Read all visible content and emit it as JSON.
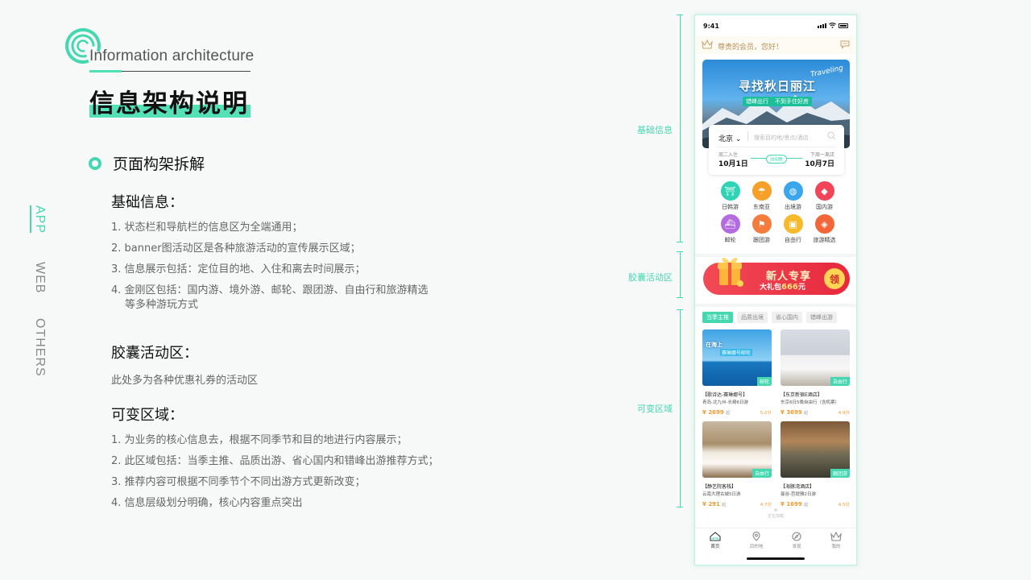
{
  "header": {
    "en_title": "Information architecture",
    "cn_title": "信息架构说明"
  },
  "side_tabs": [
    "APP",
    "WEB",
    "OTHERS"
  ],
  "section": {
    "title": "页面构架拆解",
    "basic": {
      "title": "基础信息：",
      "items": [
        "1. 状态栏和导航栏的信息区为全端通用；",
        "2. banner图活动区是各种旅游活动的宣传展示区域；",
        "3. 信息展示包括：定位目的地、入住和离去时间展示；",
        "4. 金刚区包括：国内游、境外游、邮轮、跟团游、自由行和旅游精选"
      ],
      "item4_cont": "等多种游玩方式"
    },
    "capsule": {
      "title": "胶囊活动区：",
      "text": "此处多为各种优惠礼券的活动区"
    },
    "variable": {
      "title": "可变区域：",
      "items": [
        "1. 为业务的核心信息去，根据不同季节和目的地进行内容展示；",
        "2. 此区域包括：当季主推、品质出游、省心国内和错峰出游推荐方式；",
        "3. 推荐内容可根据不同季节个不同出游方式更新改变；",
        "4. 信息层级划分明确，核心内容重点突出"
      ]
    }
  },
  "annotations": {
    "basic": "基础信息",
    "capsule": "胶囊活动区",
    "variable": "可变区域"
  },
  "phone": {
    "time": "9:41",
    "greeting": "尊贵的会员，您好！",
    "banner": {
      "title": "寻找秋日丽江",
      "script": "Traveling",
      "chip1": "错峰出行",
      "chip2": "不到手住好房"
    },
    "search": {
      "city": "北京",
      "placeholder": "搜索目的地/景点/酒店",
      "checkin_label": "周二入住",
      "checkin": "10月1日",
      "checkout_label": "下周一离店",
      "checkout": "10月7日",
      "nights": "共6晚"
    },
    "categories": [
      {
        "label": "日韩游",
        "icon": "torii-icon",
        "color": "#2fd3b5",
        "glyph": "⛩"
      },
      {
        "label": "东南亚",
        "icon": "island-icon",
        "color": "#f6a02a",
        "glyph": "☂"
      },
      {
        "label": "出境游",
        "icon": "globe-icon",
        "color": "#3aa6ee",
        "glyph": "◍"
      },
      {
        "label": "国内游",
        "icon": "china-map-icon",
        "color": "#f2455a",
        "glyph": "◆"
      },
      {
        "label": "邮轮",
        "icon": "cruise-icon",
        "color": "#b36be0",
        "glyph": "⛴"
      },
      {
        "label": "跟团游",
        "icon": "flag-icon",
        "color": "#f47c3c",
        "glyph": "⚑"
      },
      {
        "label": "自由行",
        "icon": "suitcase-icon",
        "color": "#f6b92a",
        "glyph": "▣"
      },
      {
        "label": "旅游精选",
        "icon": "diamond-icon",
        "color": "#f2673a",
        "glyph": "◈"
      }
    ],
    "coupon": {
      "title": "新人专享",
      "sub_prefix": "大礼包",
      "amount": "666",
      "sub_suffix": "元",
      "button": "领"
    },
    "tabs": [
      "当季主推",
      "品质出境",
      "省心国内",
      "错峰出游"
    ],
    "cards": [
      {
        "name": "【歌诗达-赛琳娜号】",
        "desc": "青岛-北九州-长崎6日游",
        "price": "2699",
        "unit": "起",
        "score": "5.0分",
        "tag": "邮轮",
        "img": "img-ship",
        "overlay1": "在海上",
        "overlay2": "赛琳娜号邮轮"
      },
      {
        "name": "【东京新宿E酒店】",
        "desc": "东京6日5晚自由行（含机票）",
        "price": "3699",
        "unit": "起",
        "score": "4.9分",
        "tag": "自由行",
        "img": "img-hotel1",
        "overlay1": "",
        "overlay2": ""
      },
      {
        "name": "【静艺院客栈】",
        "desc": "云南大理古城5日游",
        "price": "291",
        "unit": "起",
        "score": "4.7分",
        "tag": "自由行",
        "img": "img-hotel2",
        "overlay1": "",
        "overlay2": ""
      },
      {
        "name": "【海豚湾酒店】",
        "desc": "曼谷-芭提雅2日游",
        "price": "1699",
        "unit": "起",
        "score": "4.5分",
        "tag": "跟团游",
        "img": "img-hotel3",
        "overlay1": "",
        "overlay2": ""
      }
    ],
    "loading": "正在加载",
    "tabbar": [
      "首页",
      "目的地",
      "发现",
      "我的"
    ],
    "accent": "#45d8b0"
  }
}
